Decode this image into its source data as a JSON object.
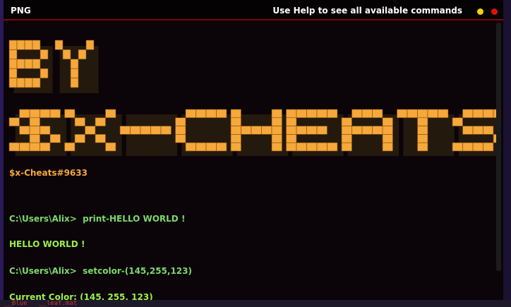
{
  "window": {
    "title": "PNG",
    "hint": "Use Help to see all available commands"
  },
  "banner": {
    "line1": "BY",
    "line2": "$X-CHEATS",
    "color": "#f6a83a"
  },
  "tag": "$x-Cheats#9633",
  "console": {
    "lines": [
      "C:\\Users\\Alix>  print-HELLO WORLD !",
      "HELLO WORLD !",
      "C:\\Users\\Alix>  setcolor-(145,255,123)",
      "Current Color: (145, 255, 123)"
    ]
  },
  "colors": {
    "background": "#0b0409",
    "titlebar_border": "#7a0a0a",
    "prompt": "#7cd96a",
    "output": "#9cf04a"
  }
}
